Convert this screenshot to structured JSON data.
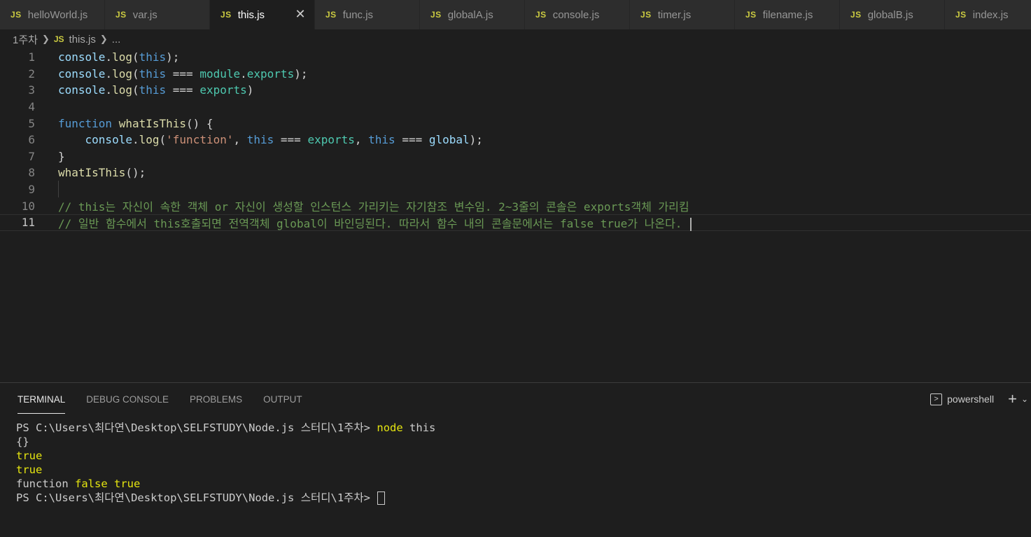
{
  "tabs": [
    {
      "icon": "JS",
      "label": "helloWorld.js"
    },
    {
      "icon": "JS",
      "label": "var.js"
    },
    {
      "icon": "JS",
      "label": "this.js",
      "active": true
    },
    {
      "icon": "JS",
      "label": "func.js"
    },
    {
      "icon": "JS",
      "label": "globalA.js"
    },
    {
      "icon": "JS",
      "label": "console.js"
    },
    {
      "icon": "JS",
      "label": "timer.js"
    },
    {
      "icon": "JS",
      "label": "filename.js"
    },
    {
      "icon": "JS",
      "label": "globalB.js"
    },
    {
      "icon": "JS",
      "label": "index.js"
    }
  ],
  "breadcrumb": {
    "folder": "1주차",
    "file_icon": "JS",
    "file": "this.js",
    "more": "..."
  },
  "editor": {
    "line_numbers": [
      "1",
      "2",
      "3",
      "4",
      "5",
      "6",
      "7",
      "8",
      "9",
      "10",
      "11"
    ],
    "current_line": 11,
    "lines": [
      "console.log(this);",
      "console.log(this === module.exports);",
      "console.log(this === exports)",
      "",
      "function whatIsThis() {",
      "    console.log('function', this === exports, this === global);",
      "}",
      "whatIsThis();",
      "",
      "// this는 자신이 속한 객체 or 자신이 생성할 인스턴스 가리키는 자기참조 변수임. 2~3줄의 콘솔은 exports객체 가리킴",
      "// 일반 함수에서 this호출되면 전역객체 global이 바인딩된다. 따라서 함수 내의 콘솔문에서는 false true가 나온다. "
    ]
  },
  "panel": {
    "tabs": [
      "TERMINAL",
      "DEBUG CONSOLE",
      "PROBLEMS",
      "OUTPUT"
    ],
    "active_tab": "TERMINAL",
    "shell_label": "powershell",
    "terminal": {
      "prompt": "PS C:\\Users\\최다연\\Desktop\\SELFSTUDY\\Node.js 스터디\\1주차>",
      "command_name": "node",
      "command_arg": "this",
      "output": [
        "{}",
        "true",
        "true"
      ],
      "func_line_prefix": "function",
      "func_line_values": "false true"
    }
  },
  "colors": {
    "js_icon": "#cbcb41",
    "keyword": "#569cd6",
    "function": "#dcdcaa",
    "variable": "#9cdcfe",
    "module": "#4ec9b0",
    "string": "#ce9178",
    "comment": "#6a9955",
    "terminal_yellow": "#e5e510"
  }
}
